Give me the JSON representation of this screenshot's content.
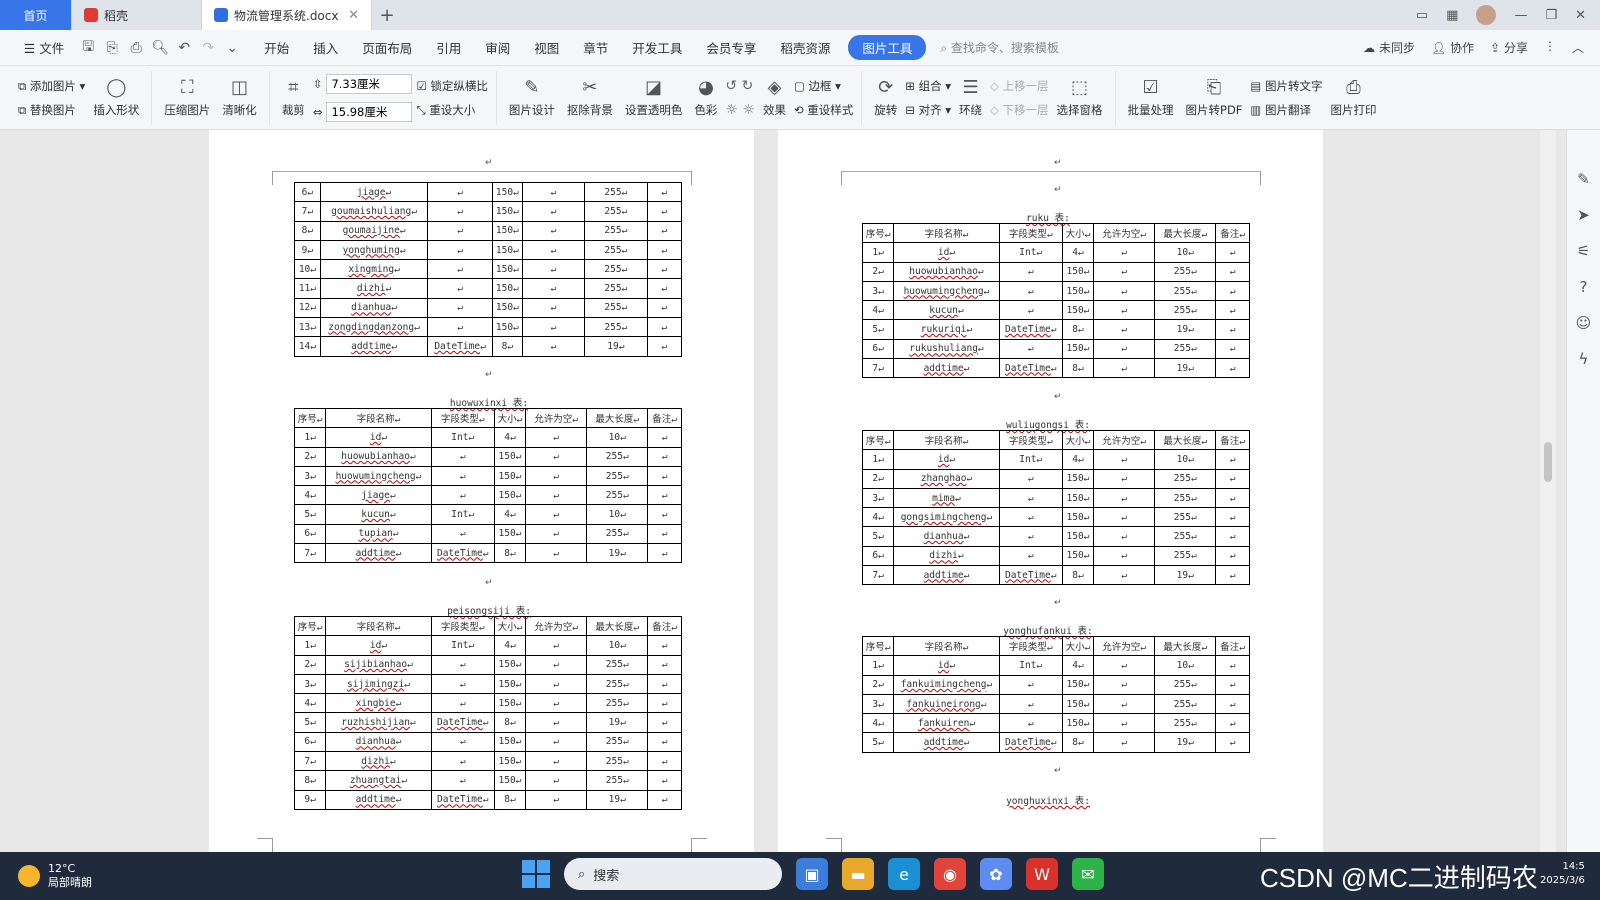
{
  "tabs": {
    "home": "首页",
    "daoke": "稻壳",
    "doc": "物流管理系统.docx",
    "new": "+"
  },
  "menu": {
    "file": "文件",
    "items": [
      "开始",
      "插入",
      "页面布局",
      "引用",
      "审阅",
      "视图",
      "章节",
      "开发工具",
      "会员专享",
      "稻壳资源"
    ],
    "active": "图片工具",
    "search": "查找命令、搜索模板",
    "sync": "未同步",
    "collab": "协作",
    "share": "分享"
  },
  "ribbon": {
    "add_image": "添加图片",
    "replace_image": "替换图片",
    "insert_shape": "插入形状",
    "compress": "压缩图片",
    "clarify": "清晰化",
    "crop": "裁剪",
    "width": "7.33厘米",
    "height": "15.98厘米",
    "lock_ratio": "锁定纵横比",
    "reset_size": "重设大小",
    "design": "图片设计",
    "cutout": "抠除背景",
    "transparent": "设置透明色",
    "color": "色彩",
    "effect": "效果",
    "border": "边框",
    "reset_style": "重设样式",
    "rotate": "旋转",
    "group": "组合",
    "align": "对齐",
    "wrap": "环绕",
    "up_layer": "上移一层",
    "down_layer": "下移一层",
    "select_pane": "选择窗格",
    "batch": "批量处理",
    "to_pdf": "图片转PDF",
    "to_text": "图片转文字",
    "translate": "图片翻译",
    "print": "图片打印"
  },
  "headers": [
    "序号",
    "字段名称",
    "字段类型",
    "大小",
    "允许为空",
    "最大长度",
    "备注"
  ],
  "mark": "↵",
  "page1": {
    "t0": {
      "rows": [
        [
          "6",
          "jiage",
          "",
          "150",
          "",
          "255",
          ""
        ],
        [
          "7",
          "goumaishuliang",
          "",
          "150",
          "",
          "255",
          ""
        ],
        [
          "8",
          "goumaijine",
          "",
          "150",
          "",
          "255",
          ""
        ],
        [
          "9",
          "yonghuming",
          "",
          "150",
          "",
          "255",
          ""
        ],
        [
          "10",
          "xingming",
          "",
          "150",
          "",
          "255",
          ""
        ],
        [
          "11",
          "dizhi",
          "",
          "150",
          "",
          "255",
          ""
        ],
        [
          "12",
          "dianhua",
          "",
          "150",
          "",
          "255",
          ""
        ],
        [
          "13",
          "zongdingdanzong",
          "",
          "150",
          "",
          "255",
          ""
        ],
        [
          "14",
          "addtime",
          "DateTime",
          "8",
          "",
          "19",
          ""
        ]
      ]
    },
    "t1": {
      "caption": "huowuxinxi 表:",
      "rows": [
        [
          "1",
          "id",
          "Int",
          "4",
          "",
          "10",
          ""
        ],
        [
          "2",
          "huowubianhao",
          "",
          "150",
          "",
          "255",
          ""
        ],
        [
          "3",
          "huowumingcheng",
          "",
          "150",
          "",
          "255",
          ""
        ],
        [
          "4",
          "jiage",
          "",
          "150",
          "",
          "255",
          ""
        ],
        [
          "5",
          "kucun",
          "Int",
          "4",
          "",
          "10",
          ""
        ],
        [
          "6",
          "tupian",
          "",
          "150",
          "",
          "255",
          ""
        ],
        [
          "7",
          "addtime",
          "DateTime",
          "8",
          "",
          "19",
          ""
        ]
      ]
    },
    "t2": {
      "caption": "peisongsiji 表:",
      "rows": [
        [
          "1",
          "id",
          "Int",
          "4",
          "",
          "10",
          ""
        ],
        [
          "2",
          "sijibianhao",
          "",
          "150",
          "",
          "255",
          ""
        ],
        [
          "3",
          "sijimingzi",
          "",
          "150",
          "",
          "255",
          ""
        ],
        [
          "4",
          "xingbie",
          "",
          "150",
          "",
          "255",
          ""
        ],
        [
          "5",
          "ruzhishijian",
          "DateTime",
          "8",
          "",
          "19",
          ""
        ],
        [
          "6",
          "dianhua",
          "",
          "150",
          "",
          "255",
          ""
        ],
        [
          "7",
          "dizhi",
          "",
          "150",
          "",
          "255",
          ""
        ],
        [
          "8",
          "zhuangtai",
          "",
          "150",
          "",
          "255",
          ""
        ],
        [
          "9",
          "addtime",
          "DateTime",
          "8",
          "",
          "19",
          ""
        ]
      ]
    }
  },
  "page2": {
    "t3": {
      "caption": "ruku 表:",
      "rows": [
        [
          "1",
          "id",
          "Int",
          "4",
          "",
          "10",
          ""
        ],
        [
          "2",
          "huowubianhao",
          "",
          "150",
          "",
          "255",
          ""
        ],
        [
          "3",
          "huowumingcheng",
          "",
          "150",
          "",
          "255",
          ""
        ],
        [
          "4",
          "kucun",
          "",
          "150",
          "",
          "255",
          ""
        ],
        [
          "5",
          "rukuriqi",
          "DateTime",
          "8",
          "",
          "19",
          ""
        ],
        [
          "6",
          "rukushuliang",
          "",
          "150",
          "",
          "255",
          ""
        ],
        [
          "7",
          "addtime",
          "DateTime",
          "8",
          "",
          "19",
          ""
        ]
      ]
    },
    "t4": {
      "caption": "wuliugongsi 表:",
      "rows": [
        [
          "1",
          "id",
          "Int",
          "4",
          "",
          "10",
          ""
        ],
        [
          "2",
          "zhanghao",
          "",
          "150",
          "",
          "255",
          ""
        ],
        [
          "3",
          "mima",
          "",
          "150",
          "",
          "255",
          ""
        ],
        [
          "4",
          "gongsimingcheng",
          "",
          "150",
          "",
          "255",
          ""
        ],
        [
          "5",
          "dianhua",
          "",
          "150",
          "",
          "255",
          ""
        ],
        [
          "6",
          "dizhi",
          "",
          "150",
          "",
          "255",
          ""
        ],
        [
          "7",
          "addtime",
          "DateTime",
          "8",
          "",
          "19",
          ""
        ]
      ]
    },
    "t5": {
      "caption": "yonghufankui 表:",
      "rows": [
        [
          "1",
          "id",
          "Int",
          "4",
          "",
          "10",
          ""
        ],
        [
          "2",
          "fankuimingcheng",
          "",
          "150",
          "",
          "255",
          ""
        ],
        [
          "3",
          "fankuineirong",
          "",
          "150",
          "",
          "255",
          ""
        ],
        [
          "4",
          "fankuiren",
          "",
          "150",
          "",
          "255",
          ""
        ],
        [
          "5",
          "addtime",
          "DateTime",
          "8",
          "",
          "19",
          ""
        ]
      ]
    },
    "t6": {
      "caption": "yonghuxinxi 表:"
    }
  },
  "taskbar": {
    "temp": "12°C",
    "weather": "局部晴朗",
    "search": "搜索",
    "watermark": "CSDN @MC二进制码农",
    "time": "14:5",
    "date": "2025/3/6"
  }
}
